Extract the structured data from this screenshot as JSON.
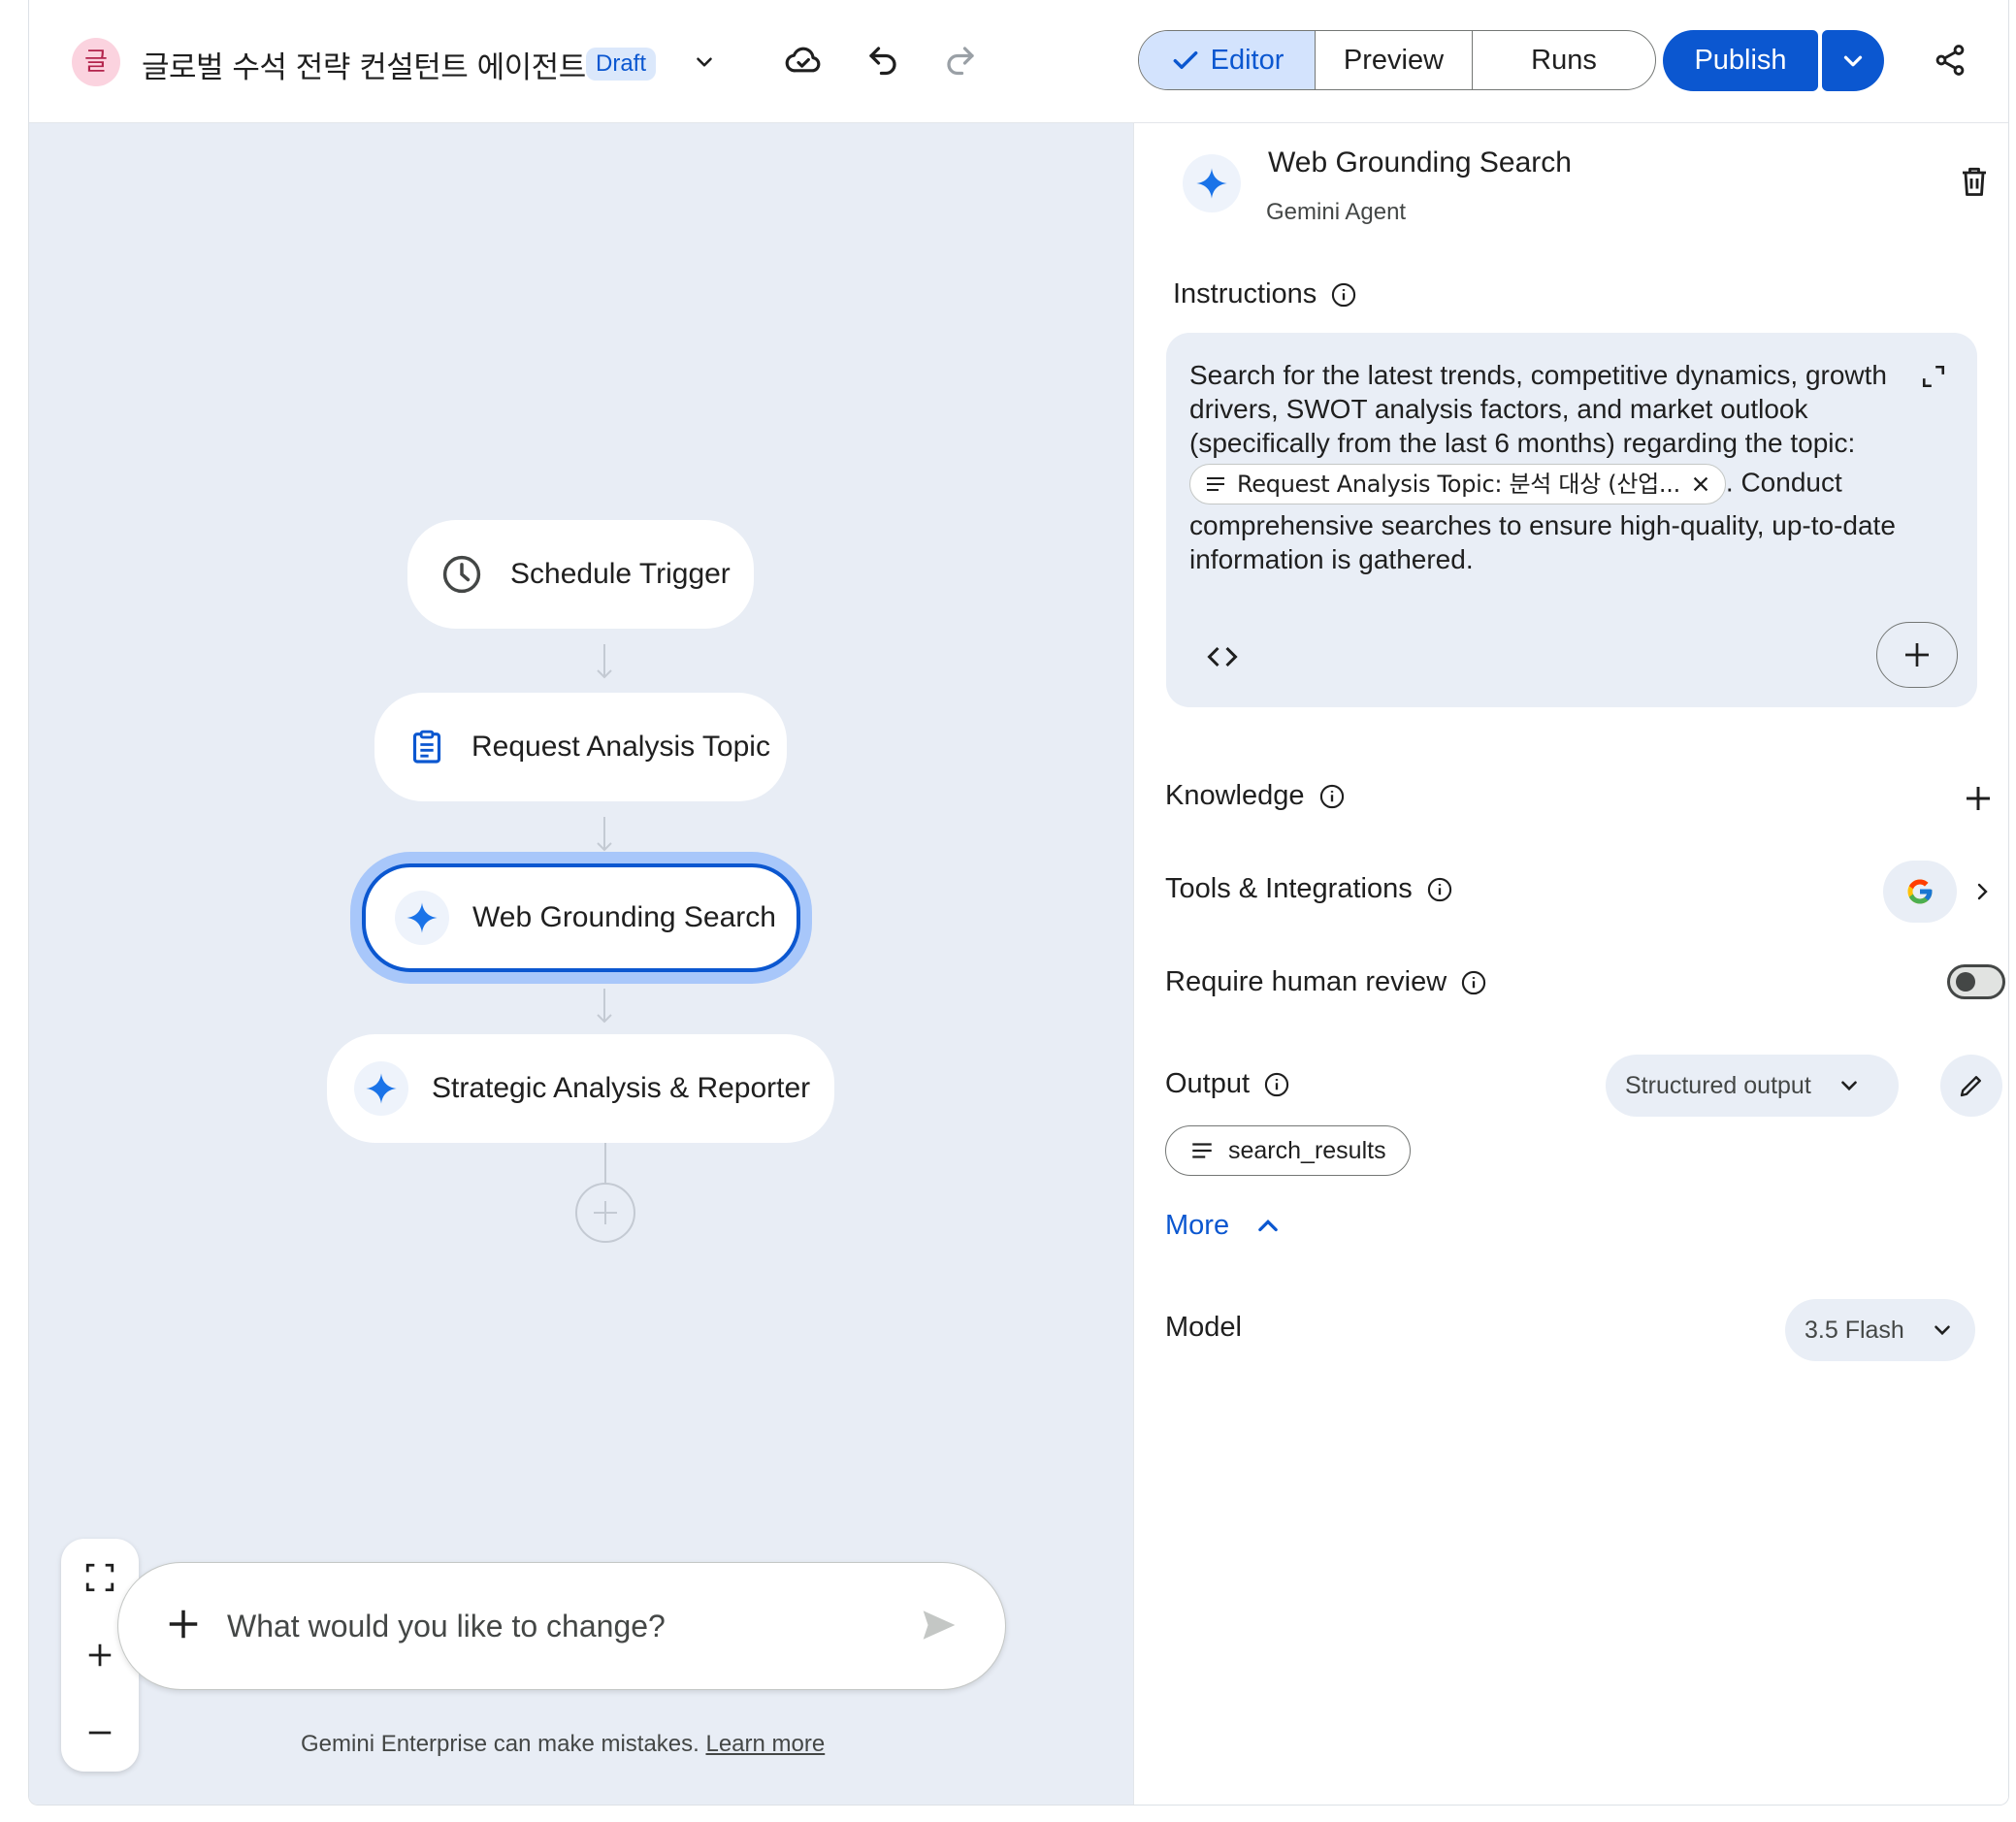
{
  "header": {
    "avatar_letter": "글",
    "title": "글로벌 수석 전략 컨설턴트 에이전트",
    "status_badge": "Draft",
    "tabs": [
      {
        "label": "Editor",
        "active": true
      },
      {
        "label": "Preview",
        "active": false
      },
      {
        "label": "Runs",
        "active": false
      }
    ],
    "publish_label": "Publish"
  },
  "canvas": {
    "nodes": [
      {
        "label": "Schedule Trigger",
        "icon": "clock-icon"
      },
      {
        "label": "Request Analysis Topic",
        "icon": "clipboard-icon"
      },
      {
        "label": "Web Grounding Search",
        "icon": "sparkle-icon",
        "selected": true
      },
      {
        "label": "Strategic Analysis & Reporter",
        "icon": "sparkle-icon"
      }
    ],
    "chat_placeholder": "What would you like to change?",
    "disclaimer": "Gemini Enterprise can make mistakes.",
    "learn_more": "Learn more"
  },
  "panel": {
    "title": "Web Grounding Search",
    "subtitle": "Gemini Agent",
    "instructions_label": "Instructions",
    "instructions_before": "Search for the latest trends, competitive dynamics, growth drivers, SWOT analysis factors, and market outlook (specifically from the last 6 months) regarding the topic:",
    "instructions_chip": "Request Analysis Topic: 분석 대상 (산업...",
    "instructions_after": ". Conduct comprehensive searches to ensure high-quality, up-to-date information is gathered.",
    "knowledge_label": "Knowledge",
    "tools_label": "Tools & Integrations",
    "review_label": "Require human review",
    "review_enabled": false,
    "output_label": "Output",
    "output_mode": "Structured output",
    "output_field": "search_results",
    "more_label": "More",
    "model_label": "Model",
    "model_value": "3.5 Flash"
  },
  "colors": {
    "accent": "#0b57d0",
    "accent_light": "#d3e3fd",
    "canvas_bg": "#e8edf5",
    "selected_ring": "#a8c7fa",
    "panel_box": "#e9eef6"
  }
}
